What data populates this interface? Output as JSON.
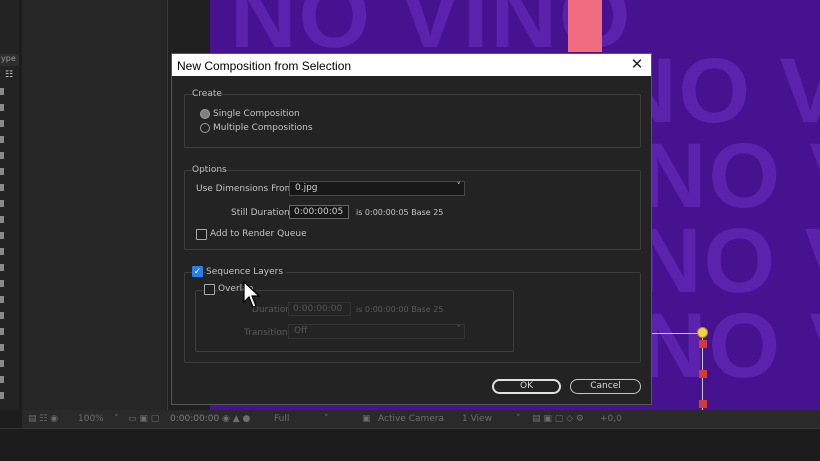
{
  "background": {
    "left_panel_header": "ype",
    "canvas_text": "NO VINO",
    "viewer_bar": {
      "zoom": "100%",
      "timecode": "0:00:00:00",
      "resolution": "Full",
      "camera": "Active Camera",
      "views": "1 View",
      "exposure": "+0,0"
    }
  },
  "dialog": {
    "title": "New Composition from Selection",
    "create": {
      "label": "Create",
      "single": "Single Composition",
      "multiple": "Multiple Compositions"
    },
    "options": {
      "label": "Options",
      "use_dimensions_label": "Use Dimensions From:",
      "use_dimensions_value": "0.jpg",
      "still_duration_label": "Still Duration:",
      "still_duration_value": "0:00:00:05",
      "still_duration_info": "is 0:00:00:05  Base 25",
      "add_render_queue": "Add to Render Queue"
    },
    "sequence": {
      "sequence_layers": "Sequence Layers",
      "overlap": "Overlap",
      "duration_label": "Duration:",
      "duration_value": "0:00:00:00",
      "duration_info": "is 0:00:00:00  Base 25",
      "transition_label": "Transition:",
      "transition_value": "Off"
    },
    "ok": "OK",
    "cancel": "Cancel"
  }
}
